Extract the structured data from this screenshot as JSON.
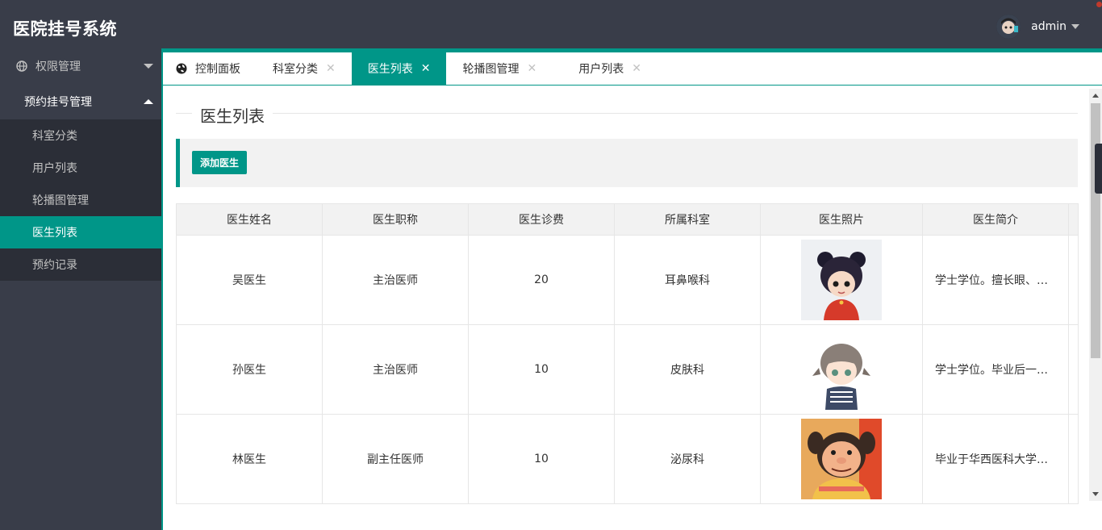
{
  "header": {
    "title": "医院挂号系统",
    "username": "admin"
  },
  "sidebar": {
    "groups": [
      {
        "label": "权限管理",
        "expanded": false
      },
      {
        "label": "预约挂号管理",
        "expanded": true
      }
    ],
    "items": [
      {
        "label": "科室分类"
      },
      {
        "label": "用户列表"
      },
      {
        "label": "轮播图管理"
      },
      {
        "label": "医生列表",
        "active": true
      },
      {
        "label": "预约记录"
      }
    ]
  },
  "tabs": [
    {
      "label": "控制面板",
      "icon": "globe-icon"
    },
    {
      "label": "科室分类",
      "closable": true
    },
    {
      "label": "医生列表",
      "closable": true,
      "active": true
    },
    {
      "label": "轮播图管理",
      "closable": true
    },
    {
      "label": "用户列表",
      "closable": true
    }
  ],
  "page": {
    "title": "医生列表",
    "add_button": "添加医生"
  },
  "table": {
    "headers": [
      "医生姓名",
      "医生职称",
      "医生诊费",
      "所属科室",
      "医生照片",
      "医生简介"
    ],
    "rows": [
      {
        "name": "吴医生",
        "title": "主治医师",
        "fee": "20",
        "dept": "耳鼻喉科",
        "photo": "cartoon-girl-red-dress",
        "intro": "学士学位。擅长眼、…"
      },
      {
        "name": "孙医生",
        "title": "主治医师",
        "fee": "10",
        "dept": "皮肤科",
        "photo": "cartoon-girl-pigtails",
        "intro": "学士学位。毕业后一…"
      },
      {
        "name": "林医生",
        "title": "副主任医师",
        "fee": "10",
        "dept": "泌尿科",
        "photo": "cartoon-girl-yellow-shirt",
        "intro": "毕业于华西医科大学…"
      }
    ]
  },
  "colors": {
    "accent": "#009688",
    "header_bg": "#393d49",
    "subnav_bg": "#2b2e37"
  }
}
